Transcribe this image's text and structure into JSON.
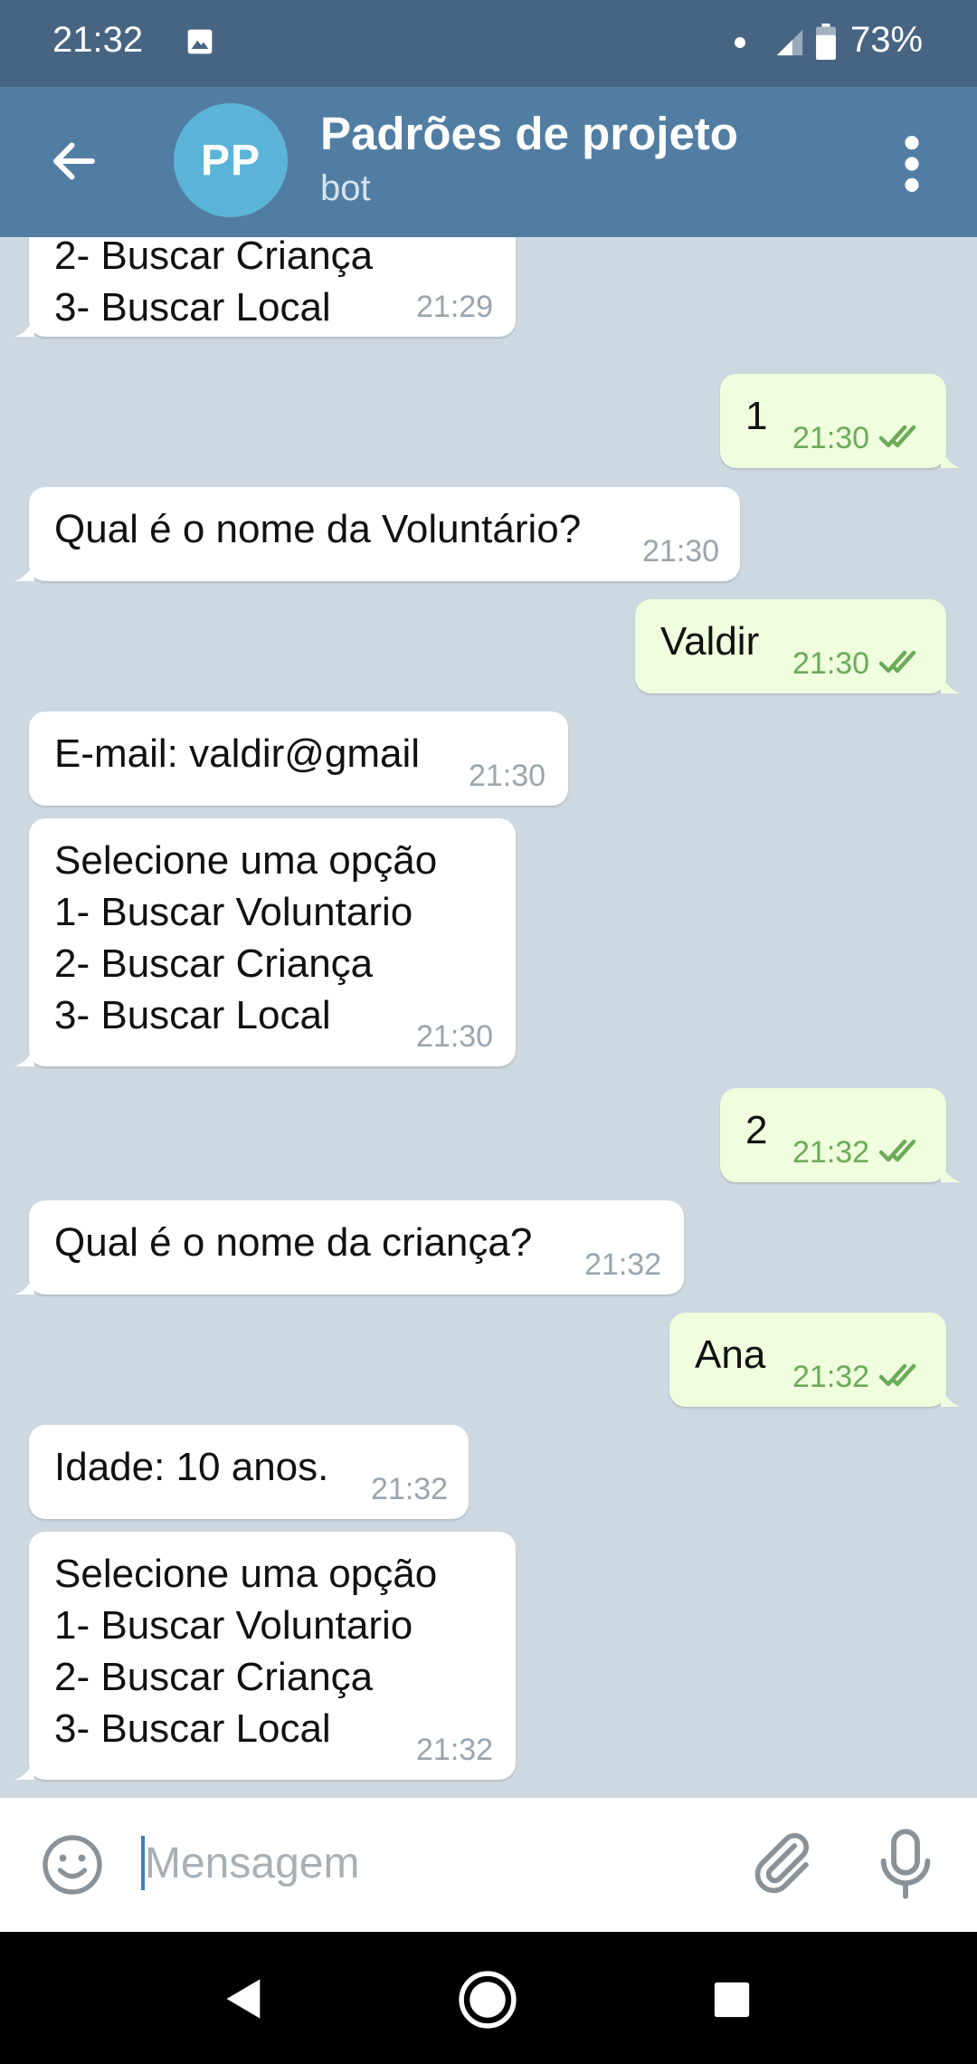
{
  "status_bar": {
    "time": "21:32",
    "battery_percent": "73%"
  },
  "header": {
    "avatar_initials": "PP",
    "title": "Padrões de projeto",
    "subtitle": "bot"
  },
  "messages": [
    {
      "direction": "in",
      "text": "2- Buscar Criança\n3- Buscar Local",
      "time": "21:29"
    },
    {
      "direction": "out",
      "text": "1",
      "time": "21:30",
      "status": "read"
    },
    {
      "direction": "in",
      "text": "Qual é o nome da Voluntário?",
      "time": "21:30"
    },
    {
      "direction": "out",
      "text": "Valdir",
      "time": "21:30",
      "status": "read"
    },
    {
      "direction": "in",
      "text": "E-mail: valdir@gmail",
      "time": "21:30"
    },
    {
      "direction": "in",
      "text": "Selecione uma opção\n1- Buscar Voluntario\n2- Buscar Criança\n3- Buscar Local",
      "time": "21:30"
    },
    {
      "direction": "out",
      "text": "2",
      "time": "21:32",
      "status": "read"
    },
    {
      "direction": "in",
      "text": "Qual é o nome da criança?",
      "time": "21:32"
    },
    {
      "direction": "out",
      "text": "Ana",
      "time": "21:32",
      "status": "read"
    },
    {
      "direction": "in",
      "text": "Idade: 10 anos.",
      "time": "21:32"
    },
    {
      "direction": "in",
      "text": "Selecione uma opção\n1- Buscar Voluntario\n2- Buscar Criança\n3- Buscar Local",
      "time": "21:32"
    }
  ],
  "composer": {
    "placeholder": "Mensagem"
  },
  "icons": {
    "status": [
      "image-icon",
      "dot-icon",
      "signal-icon",
      "battery-icon"
    ],
    "header": [
      "back-arrow-icon",
      "more-vert-icon"
    ],
    "composer": [
      "emoji-icon",
      "attach-icon",
      "mic-icon"
    ],
    "nav": [
      "nav-back-icon",
      "nav-home-icon",
      "nav-recent-icon"
    ]
  },
  "colors": {
    "status_bar": "#476583",
    "app_bar": "#527da3",
    "avatar": "#5bb4d8",
    "chat_background": "#cdd8e0",
    "outgoing_bubble": "#effedd",
    "incoming_bubble": "#ffffff",
    "read_ticks": "#6bab5a"
  }
}
